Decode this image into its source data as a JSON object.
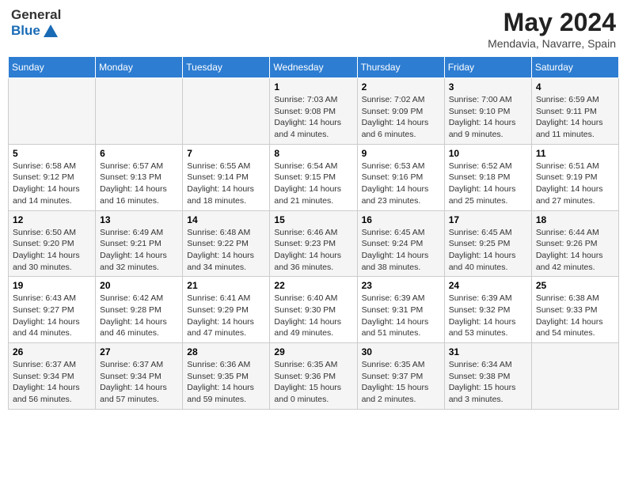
{
  "header": {
    "logo_general": "General",
    "logo_blue": "Blue",
    "main_title": "May 2024",
    "subtitle": "Mendavia, Navarre, Spain"
  },
  "weekdays": [
    "Sunday",
    "Monday",
    "Tuesday",
    "Wednesday",
    "Thursday",
    "Friday",
    "Saturday"
  ],
  "weeks": [
    [
      {
        "day": "",
        "info": ""
      },
      {
        "day": "",
        "info": ""
      },
      {
        "day": "",
        "info": ""
      },
      {
        "day": "1",
        "info": "Sunrise: 7:03 AM\nSunset: 9:08 PM\nDaylight: 14 hours\nand 4 minutes."
      },
      {
        "day": "2",
        "info": "Sunrise: 7:02 AM\nSunset: 9:09 PM\nDaylight: 14 hours\nand 6 minutes."
      },
      {
        "day": "3",
        "info": "Sunrise: 7:00 AM\nSunset: 9:10 PM\nDaylight: 14 hours\nand 9 minutes."
      },
      {
        "day": "4",
        "info": "Sunrise: 6:59 AM\nSunset: 9:11 PM\nDaylight: 14 hours\nand 11 minutes."
      }
    ],
    [
      {
        "day": "5",
        "info": "Sunrise: 6:58 AM\nSunset: 9:12 PM\nDaylight: 14 hours\nand 14 minutes."
      },
      {
        "day": "6",
        "info": "Sunrise: 6:57 AM\nSunset: 9:13 PM\nDaylight: 14 hours\nand 16 minutes."
      },
      {
        "day": "7",
        "info": "Sunrise: 6:55 AM\nSunset: 9:14 PM\nDaylight: 14 hours\nand 18 minutes."
      },
      {
        "day": "8",
        "info": "Sunrise: 6:54 AM\nSunset: 9:15 PM\nDaylight: 14 hours\nand 21 minutes."
      },
      {
        "day": "9",
        "info": "Sunrise: 6:53 AM\nSunset: 9:16 PM\nDaylight: 14 hours\nand 23 minutes."
      },
      {
        "day": "10",
        "info": "Sunrise: 6:52 AM\nSunset: 9:18 PM\nDaylight: 14 hours\nand 25 minutes."
      },
      {
        "day": "11",
        "info": "Sunrise: 6:51 AM\nSunset: 9:19 PM\nDaylight: 14 hours\nand 27 minutes."
      }
    ],
    [
      {
        "day": "12",
        "info": "Sunrise: 6:50 AM\nSunset: 9:20 PM\nDaylight: 14 hours\nand 30 minutes."
      },
      {
        "day": "13",
        "info": "Sunrise: 6:49 AM\nSunset: 9:21 PM\nDaylight: 14 hours\nand 32 minutes."
      },
      {
        "day": "14",
        "info": "Sunrise: 6:48 AM\nSunset: 9:22 PM\nDaylight: 14 hours\nand 34 minutes."
      },
      {
        "day": "15",
        "info": "Sunrise: 6:46 AM\nSunset: 9:23 PM\nDaylight: 14 hours\nand 36 minutes."
      },
      {
        "day": "16",
        "info": "Sunrise: 6:45 AM\nSunset: 9:24 PM\nDaylight: 14 hours\nand 38 minutes."
      },
      {
        "day": "17",
        "info": "Sunrise: 6:45 AM\nSunset: 9:25 PM\nDaylight: 14 hours\nand 40 minutes."
      },
      {
        "day": "18",
        "info": "Sunrise: 6:44 AM\nSunset: 9:26 PM\nDaylight: 14 hours\nand 42 minutes."
      }
    ],
    [
      {
        "day": "19",
        "info": "Sunrise: 6:43 AM\nSunset: 9:27 PM\nDaylight: 14 hours\nand 44 minutes."
      },
      {
        "day": "20",
        "info": "Sunrise: 6:42 AM\nSunset: 9:28 PM\nDaylight: 14 hours\nand 46 minutes."
      },
      {
        "day": "21",
        "info": "Sunrise: 6:41 AM\nSunset: 9:29 PM\nDaylight: 14 hours\nand 47 minutes."
      },
      {
        "day": "22",
        "info": "Sunrise: 6:40 AM\nSunset: 9:30 PM\nDaylight: 14 hours\nand 49 minutes."
      },
      {
        "day": "23",
        "info": "Sunrise: 6:39 AM\nSunset: 9:31 PM\nDaylight: 14 hours\nand 51 minutes."
      },
      {
        "day": "24",
        "info": "Sunrise: 6:39 AM\nSunset: 9:32 PM\nDaylight: 14 hours\nand 53 minutes."
      },
      {
        "day": "25",
        "info": "Sunrise: 6:38 AM\nSunset: 9:33 PM\nDaylight: 14 hours\nand 54 minutes."
      }
    ],
    [
      {
        "day": "26",
        "info": "Sunrise: 6:37 AM\nSunset: 9:34 PM\nDaylight: 14 hours\nand 56 minutes."
      },
      {
        "day": "27",
        "info": "Sunrise: 6:37 AM\nSunset: 9:34 PM\nDaylight: 14 hours\nand 57 minutes."
      },
      {
        "day": "28",
        "info": "Sunrise: 6:36 AM\nSunset: 9:35 PM\nDaylight: 14 hours\nand 59 minutes."
      },
      {
        "day": "29",
        "info": "Sunrise: 6:35 AM\nSunset: 9:36 PM\nDaylight: 15 hours\nand 0 minutes."
      },
      {
        "day": "30",
        "info": "Sunrise: 6:35 AM\nSunset: 9:37 PM\nDaylight: 15 hours\nand 2 minutes."
      },
      {
        "day": "31",
        "info": "Sunrise: 6:34 AM\nSunset: 9:38 PM\nDaylight: 15 hours\nand 3 minutes."
      },
      {
        "day": "",
        "info": ""
      }
    ]
  ]
}
